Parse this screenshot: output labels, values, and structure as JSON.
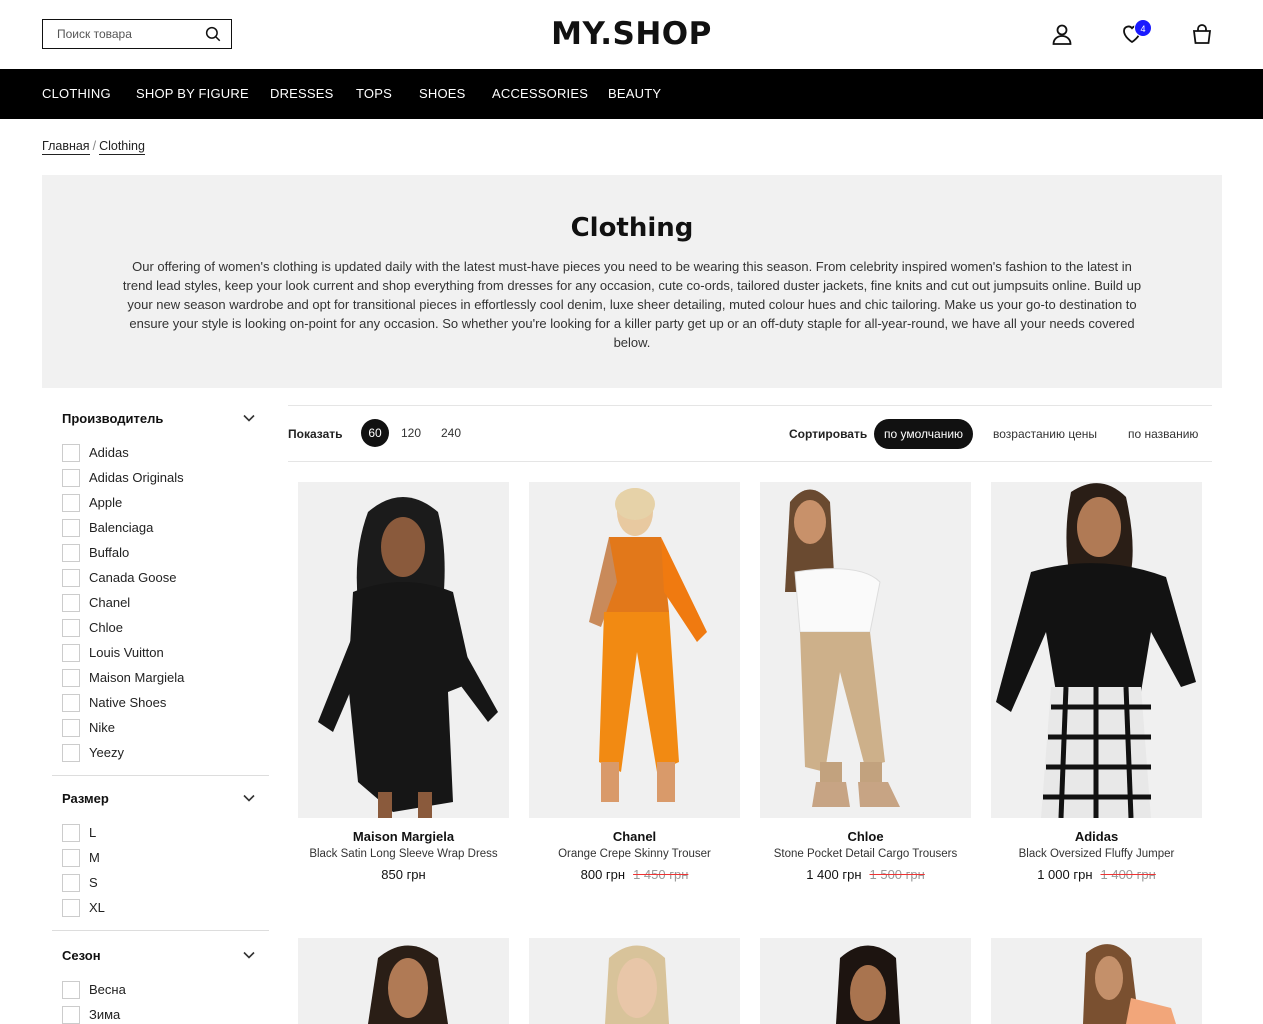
{
  "header": {
    "search_placeholder": "Поиск товара",
    "logo": "MY.SHOP",
    "favorites_count": "4"
  },
  "nav": [
    "CLOTHING",
    "SHOP BY FIGURE",
    "DRESSES",
    "TOPS",
    "SHOES",
    "ACCESSORIES",
    "BEAUTY"
  ],
  "breadcrumb": {
    "home": "Главная",
    "separator": "/",
    "current": "Clothing"
  },
  "hero": {
    "title": "Clothing",
    "text": "Our offering of women's clothing is updated daily with the latest must-have pieces you need to be wearing this season. From celebrity inspired women's fashion to the latest in trend lead styles, keep your look current and shop everything from dresses for any occasion, cute co-ords, tailored duster jackets, fine knits and cut out jumpsuits online. Build up your new season wardrobe and opt for transitional pieces in effortlessly cool denim, luxe sheer detailing, muted colour hues and chic tailoring. Make us your go-to destination to ensure your style is looking on-point for any occasion. So whether you're looking for a killer party get up or an off-duty staple for all-year-round, we have all your needs covered below."
  },
  "filters": {
    "manufacturer": {
      "title": "Производитель",
      "options": [
        "Adidas",
        "Adidas Originals",
        "Apple",
        "Balenciaga",
        "Buffalo",
        "Canada Goose",
        "Chanel",
        "Chloe",
        "Louis Vuitton",
        "Maison Margiela",
        "Native Shoes",
        "Nike",
        "Yeezy"
      ]
    },
    "size": {
      "title": "Размер",
      "options": [
        "L",
        "M",
        "S",
        "XL"
      ]
    },
    "season": {
      "title": "Сезон",
      "options": [
        "Весна",
        "Зима"
      ]
    }
  },
  "toolbar": {
    "show_label": "Показать",
    "page_sizes": [
      "60",
      "120",
      "240"
    ],
    "active_page_size": "60",
    "sort_label": "Сортировать",
    "sort_options": [
      "по умолчанию",
      "возрастанию цены",
      "по названию"
    ],
    "active_sort": "по умолчанию"
  },
  "products": [
    {
      "brand": "Maison Margiela",
      "name": "Black Satin Long Sleeve Wrap Dress",
      "price": "850 грн",
      "old_price": ""
    },
    {
      "brand": "Chanel",
      "name": "Orange Crepe Skinny Trouser",
      "price": "800 грн",
      "old_price": "1 450 грн"
    },
    {
      "brand": "Chloe",
      "name": "Stone Pocket Detail Cargo Trousers",
      "price": "1 400 грн",
      "old_price": "1 500 грн"
    },
    {
      "brand": "Adidas",
      "name": "Black Oversized Fluffy Jumper",
      "price": "1 000 грн",
      "old_price": "1 400 грн"
    }
  ],
  "colors": {
    "nav_bg": "#000000",
    "hero_bg": "#f1f1f1",
    "badge": "#1a1aff",
    "strike": "#e33333"
  }
}
